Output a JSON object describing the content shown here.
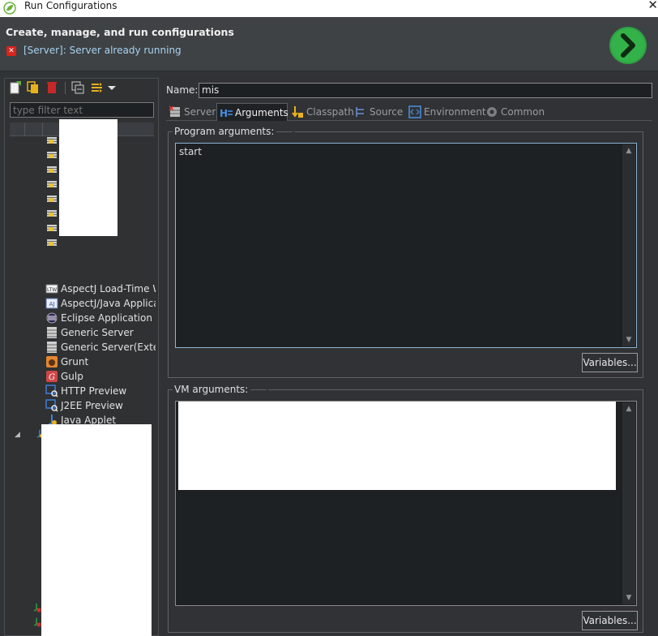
{
  "window": {
    "title": "Run Configurations",
    "close_glyph": "✕",
    "icon": "spring-leaf-icon"
  },
  "banner": {
    "heading": "Create, manage, and run configurations",
    "error_message": "[Server]: Server already running",
    "error_icon": "error-icon",
    "run_icon": "run-icon"
  },
  "left_panel": {
    "toolbar": [
      "new-configuration-icon",
      "duplicate-icon",
      "delete-icon",
      "collapse-all-icon",
      "filter-icon",
      "dropdown-icon"
    ],
    "filter_placeholder": "type filter text",
    "tree_items": [
      {
        "label": "AspectJ Load-Time Wea",
        "icon": "ltw-icon"
      },
      {
        "label": "AspectJ/Java Applicatio",
        "icon": "aspectj-app-icon"
      },
      {
        "label": "Eclipse Application",
        "icon": "eclipse-app-icon"
      },
      {
        "label": "Generic Server",
        "icon": "generic-server-icon"
      },
      {
        "label": "Generic Server(External",
        "icon": "generic-server-external-icon"
      },
      {
        "label": "Grunt",
        "icon": "grunt-icon"
      },
      {
        "label": "Gulp",
        "icon": "gulp-icon"
      },
      {
        "label": "HTTP Preview",
        "icon": "http-preview-icon"
      },
      {
        "label": "J2EE Preview",
        "icon": "j2ee-preview-icon"
      },
      {
        "label": "Java Applet",
        "icon": "java-applet-icon"
      }
    ],
    "expander_glyph": "◢"
  },
  "right_panel": {
    "name_label": "Name:",
    "name_value": "mis",
    "tabs": [
      {
        "label": "Server",
        "icon": "server-icon",
        "active": false
      },
      {
        "label": "Arguments",
        "icon": "arguments-icon",
        "active": true
      },
      {
        "label": "Classpath",
        "icon": "classpath-icon",
        "active": false
      },
      {
        "label": "Source",
        "icon": "source-icon",
        "active": false
      },
      {
        "label": "Environment",
        "icon": "environment-icon",
        "active": false
      },
      {
        "label": "Common",
        "icon": "common-icon",
        "active": false
      }
    ],
    "program_arguments": {
      "label": "Program arguments:",
      "value": "start",
      "variables_button": "Variables..."
    },
    "vm_arguments": {
      "label": "VM arguments:",
      "value": "",
      "variables_button": "Variables..."
    }
  }
}
